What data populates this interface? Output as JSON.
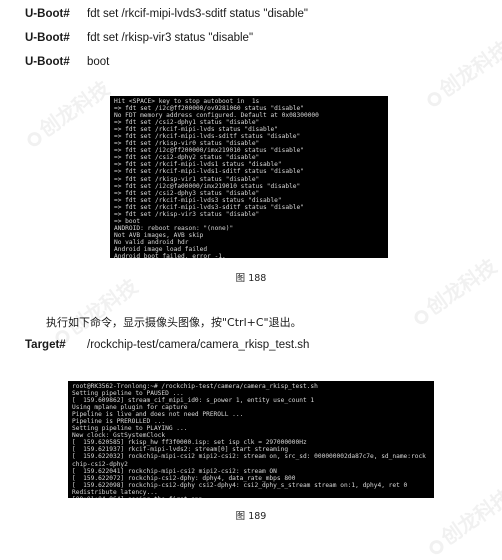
{
  "commands": [
    {
      "label": "U-Boot#",
      "text": "fdt set /rkcif-mipi-lvds3-sditf status \"disable\""
    },
    {
      "label": "U-Boot#",
      "text": "fdt set /rkisp-vir3 status \"disable\""
    },
    {
      "label": "U-Boot#",
      "text": "boot"
    }
  ],
  "terminal1": {
    "lines": [
      "Hit <SPACE> key to stop autoboot in  1s",
      "=> fdt set /i2c@ff200000/ov9281060 status \"disable\"",
      "No FDT memory address configured. Default at 0x08300000",
      "=> fdt set /csi2-dphy1 status \"disable\"",
      "=> fdt set /rkcif-mipi-lvds status \"disable\"",
      "=> fdt set /rkcif-mipi-lvds-sditf status \"disable\"",
      "=> fdt set /rkisp-vir0 status \"disable\"",
      "=> fdt set /i2c@ff200000/imx219010 status \"disable\"",
      "=> fdt set /csi2-dphy2 status \"disable\"",
      "=> fdt set /rkcif-mipi-lvds1 status \"disable\"",
      "=> fdt set /rkcif-mipi-lvds1-sditf status \"disable\"",
      "=> fdt set /rkisp-vir1 status \"disable\"",
      "=> fdt set /i2c@fa00000/imx219010 status \"disable\"",
      "=> fdt set /csi2-dphy3 status \"disable\"",
      "=> fdt set /rkcif-mipi-lvds3 status \"disable\"",
      "=> fdt set /rkcif-mipi-lvds3-sditf status \"disable\"",
      "=> fdt set /rkisp-vir3 status \"disable\"",
      "=> boot",
      "ANDROID: reboot reason: \"(none)\"",
      "Not AVB images, AVB skip",
      "No valid android hdr",
      "Android image load failed",
      "Android boot failed, error -1.",
      "## Booting FIT Image"
    ]
  },
  "caption1": "图  188",
  "instruction": "执行如下命令，显示摄像头图像，按\"Ctrl+C\"退出。",
  "target": {
    "label": "Target#",
    "text": "/rockchip-test/camera/camera_rkisp_test.sh"
  },
  "terminal2": {
    "lines": [
      "root@RK3562-Tronlong:~# /rockchip-test/camera/camera_rkisp_test.sh",
      "Setting pipeline to PAUSED ...",
      "[  159.609862] stream_cif_mipi_id0: s_power 1, entity use_count 1",
      "Using mplane plugin for capture",
      "Pipeline is live and does not need PREROLL ...",
      "Pipeline is PREROLLED ...",
      "Setting pipeline to PLAYING ...",
      "New clock: GstSystemClock",
      "[  159.620585] rkisp_hw ff3f0000.isp: set isp clk = 297000000Hz",
      "[  159.621937] rkcif-mipi-lvds2: stream[0] start streaming",
      "[  159.622032] rockchip-mipi-csi2 mipi2-csi2: stream on, src_sd: 000000002da87c7e, sd_name:rock",
      "chip-csi2-dphy2",
      "[  159.622041] rockchip-mipi-csi2 mipi2-csi2: stream ON",
      "[  159.622072] rockchip-csi2-dphy: dphy4, data_rate_mbps 800",
      "[  159.622098] rockchip-csi2-dphy csi2-dphy4: csi2_dphy_s_stream stream on:1, dphy4, ret 0",
      "Redistribute latency...",
      "[00:01:04.964] seeing the first app",
      "0:00:25.2 / 99:99:99."
    ]
  },
  "caption2": "图  189",
  "watermark": "创龙科技"
}
